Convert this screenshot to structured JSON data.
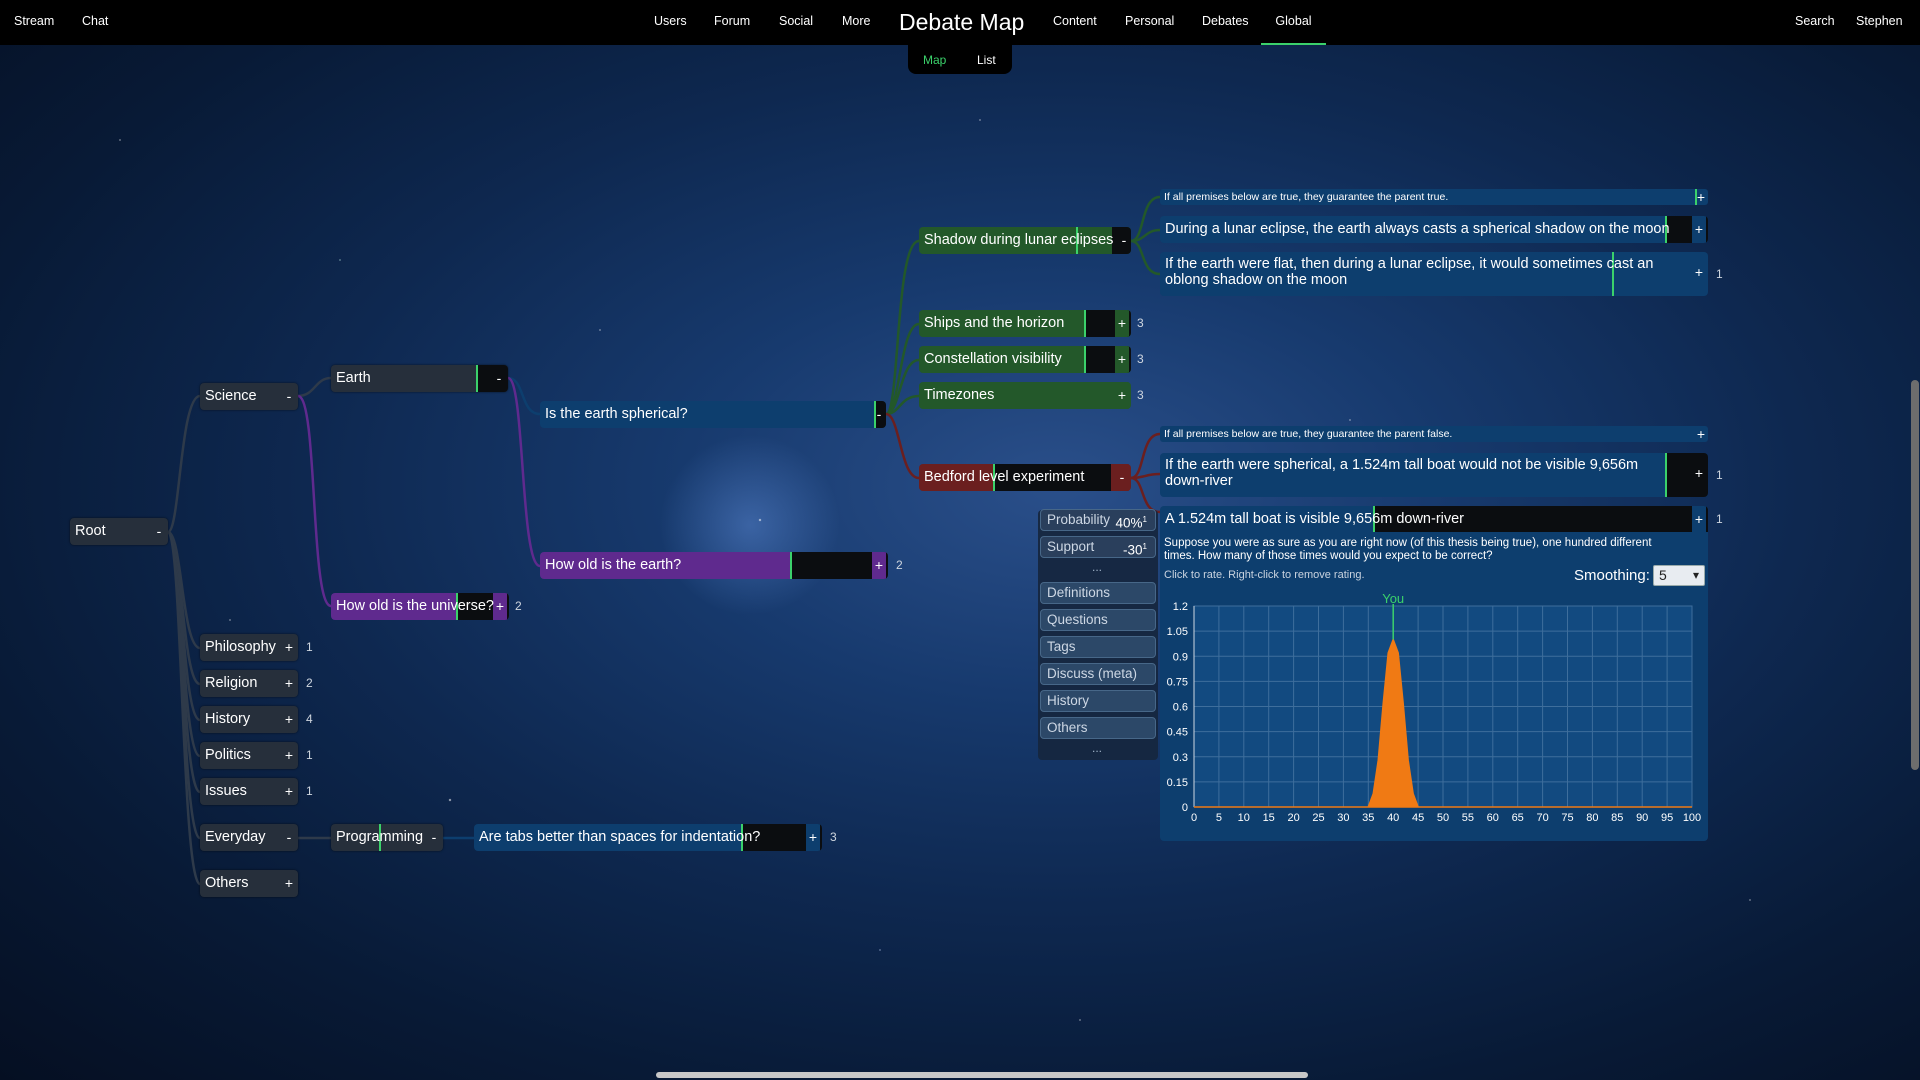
{
  "nav": {
    "left": [
      "Stream",
      "Chat"
    ],
    "center_left": [
      "Users",
      "Forum",
      "Social",
      "More"
    ],
    "title": "Debate Map",
    "center_right": [
      "Content",
      "Personal",
      "Debates",
      "Global"
    ],
    "right": [
      "Search",
      "Stephen"
    ],
    "active": "Global",
    "accent": "#3bd16b"
  },
  "subnav": {
    "map": "Map",
    "list": "List",
    "active": "Map"
  },
  "tree": {
    "root": "Root",
    "science": "Science",
    "earth": "Earth",
    "spherical": "Is the earth spherical?",
    "earth_age": "How old is the earth?",
    "earth_age_count": "2",
    "universe_age": "How old is the universe?",
    "universe_age_count": "2",
    "lunar": "Shadow during lunar eclipses",
    "ships": "Ships and the horizon",
    "ships_count": "3",
    "constellation": "Constellation visibility",
    "constellation_count": "3",
    "timezones": "Timezones",
    "timezones_count": "3",
    "bedford": "Bedford level experiment",
    "premise_note_true": "If all premises below are true, they guarantee the parent true.",
    "lunar_p1": "During a lunar eclipse, the earth always casts a spherical shadow on the moon",
    "lunar_p2": "If the earth were flat, then during a lunar eclipse, it would sometimes cast an oblong shadow on the moon",
    "lunar_p2_count": "1",
    "premise_note_false": "If all premises below are true, they guarantee the parent false.",
    "bedford_p1": "If the earth were spherical, a 1.524m tall boat would not be visible 9,656m down-river",
    "bedford_p1_count": "1",
    "bedford_p2": "A 1.524m tall boat is visible 9,656m down-river",
    "bedford_p2_count": "1",
    "philosophy": "Philosophy",
    "philosophy_count": "1",
    "religion": "Religion",
    "religion_count": "2",
    "history": "History",
    "history_count": "4",
    "politics": "Politics",
    "politics_count": "1",
    "issues": "Issues",
    "issues_count": "1",
    "everyday": "Everyday",
    "programming": "Programming",
    "tabs": "Are tabs better than spaces for indentation?",
    "tabs_count": "3",
    "others": "Others"
  },
  "side_menu": {
    "probability_label": "Probability",
    "probability_value": "40%",
    "probability_sup": "1",
    "support_label": "Support",
    "support_value": "-30",
    "support_sup": "1",
    "items": [
      "Definitions",
      "Questions",
      "Tags",
      "Discuss (meta)",
      "History",
      "Others"
    ],
    "more": "..."
  },
  "rating": {
    "question": "Suppose you were as sure as you are right now (of this thesis being true), one hundred different times. How many of those times would you expect to be correct?",
    "hint": "Click to rate. Right-click to remove rating.",
    "smoothing_label": "Smoothing:",
    "smoothing_value": "5"
  },
  "chart_data": {
    "type": "area",
    "x": [
      0,
      5,
      10,
      15,
      20,
      25,
      30,
      35,
      36,
      37,
      38,
      39,
      40,
      41,
      42,
      43,
      44,
      45,
      50,
      55,
      60,
      65,
      70,
      75,
      80,
      85,
      90,
      95,
      100
    ],
    "y": [
      0,
      0,
      0,
      0,
      0,
      0,
      0,
      0,
      0.08,
      0.28,
      0.62,
      0.92,
      1.0,
      0.92,
      0.62,
      0.28,
      0.08,
      0,
      0,
      0,
      0,
      0,
      0,
      0,
      0,
      0,
      0,
      0,
      0
    ],
    "xticks": [
      0,
      5,
      10,
      15,
      20,
      25,
      30,
      35,
      40,
      45,
      50,
      55,
      60,
      65,
      70,
      75,
      80,
      85,
      90,
      95,
      100
    ],
    "yticks": [
      "0",
      "0.15",
      "0.3",
      "0.45",
      "0.6",
      "0.75",
      "0.9",
      "1.05",
      "1.2"
    ],
    "xlim": [
      0,
      100
    ],
    "ylim": [
      0,
      1.2
    ],
    "grid": true,
    "marker": {
      "x": 40,
      "label": "You"
    },
    "fill_color": "#f07a14",
    "marker_color": "#3bd16b"
  }
}
